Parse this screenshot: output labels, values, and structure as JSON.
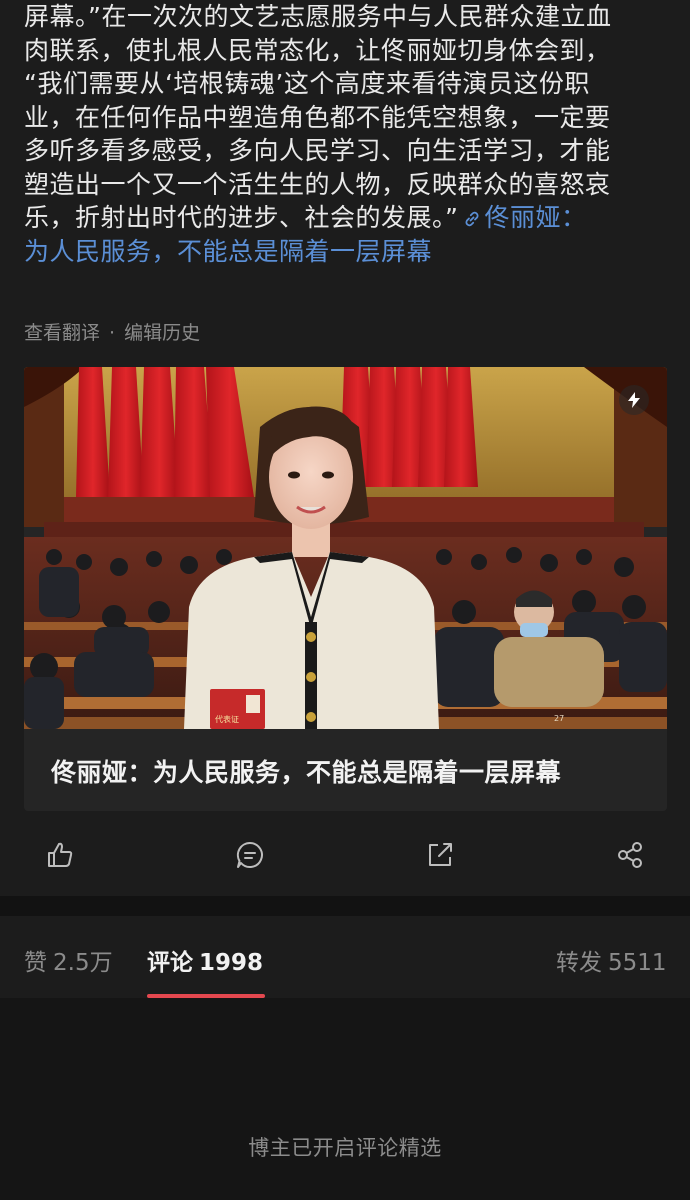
{
  "article": {
    "lines": [
      "屏幕。”在一次次的文艺志愿服务中与人民群众建立血",
      "肉联系，使扎根人民常态化，让佟丽娅切身体会到，",
      "“我们需要从‘培根铸魂’这个高度来看待演员这份职",
      "业，在任何作品中塑造角色都不能凭空想象，一定要",
      "多听多看多感受，多向人民学习、向生活学习，才能",
      "塑造出一个又一个活生生的人物，反映群众的喜怒哀"
    ],
    "last_line_text": "乐，折射出时代的进步、社会的发展。”",
    "topic_link_part1": "佟丽娅：",
    "topic_link_part2": "为人民服务，不能总是隔着一层屏幕"
  },
  "meta": {
    "translate": "查看翻译",
    "separator": "·",
    "edit_history": "编辑历史"
  },
  "card": {
    "title": "佟丽娅：为人民服务，不能总是隔着一层屏幕",
    "badge_text": "代表证",
    "seat_number": "27"
  },
  "actions": {
    "like_icon": "thumbs-up-icon",
    "comment_icon": "comment-icon",
    "repost_icon": "repost-icon",
    "share_icon": "share-icon"
  },
  "tabs": {
    "likes_label": "赞",
    "likes_count": "2.5万",
    "comments_label": "评论",
    "comments_count": "1998",
    "reposts_label": "转发",
    "reposts_count": "5511"
  },
  "comments": {
    "notice": "博主已开启评论精选"
  },
  "colors": {
    "background": "#1a1a1a",
    "link": "#5b8fd6",
    "active_tab_underline": "#e4484f"
  }
}
